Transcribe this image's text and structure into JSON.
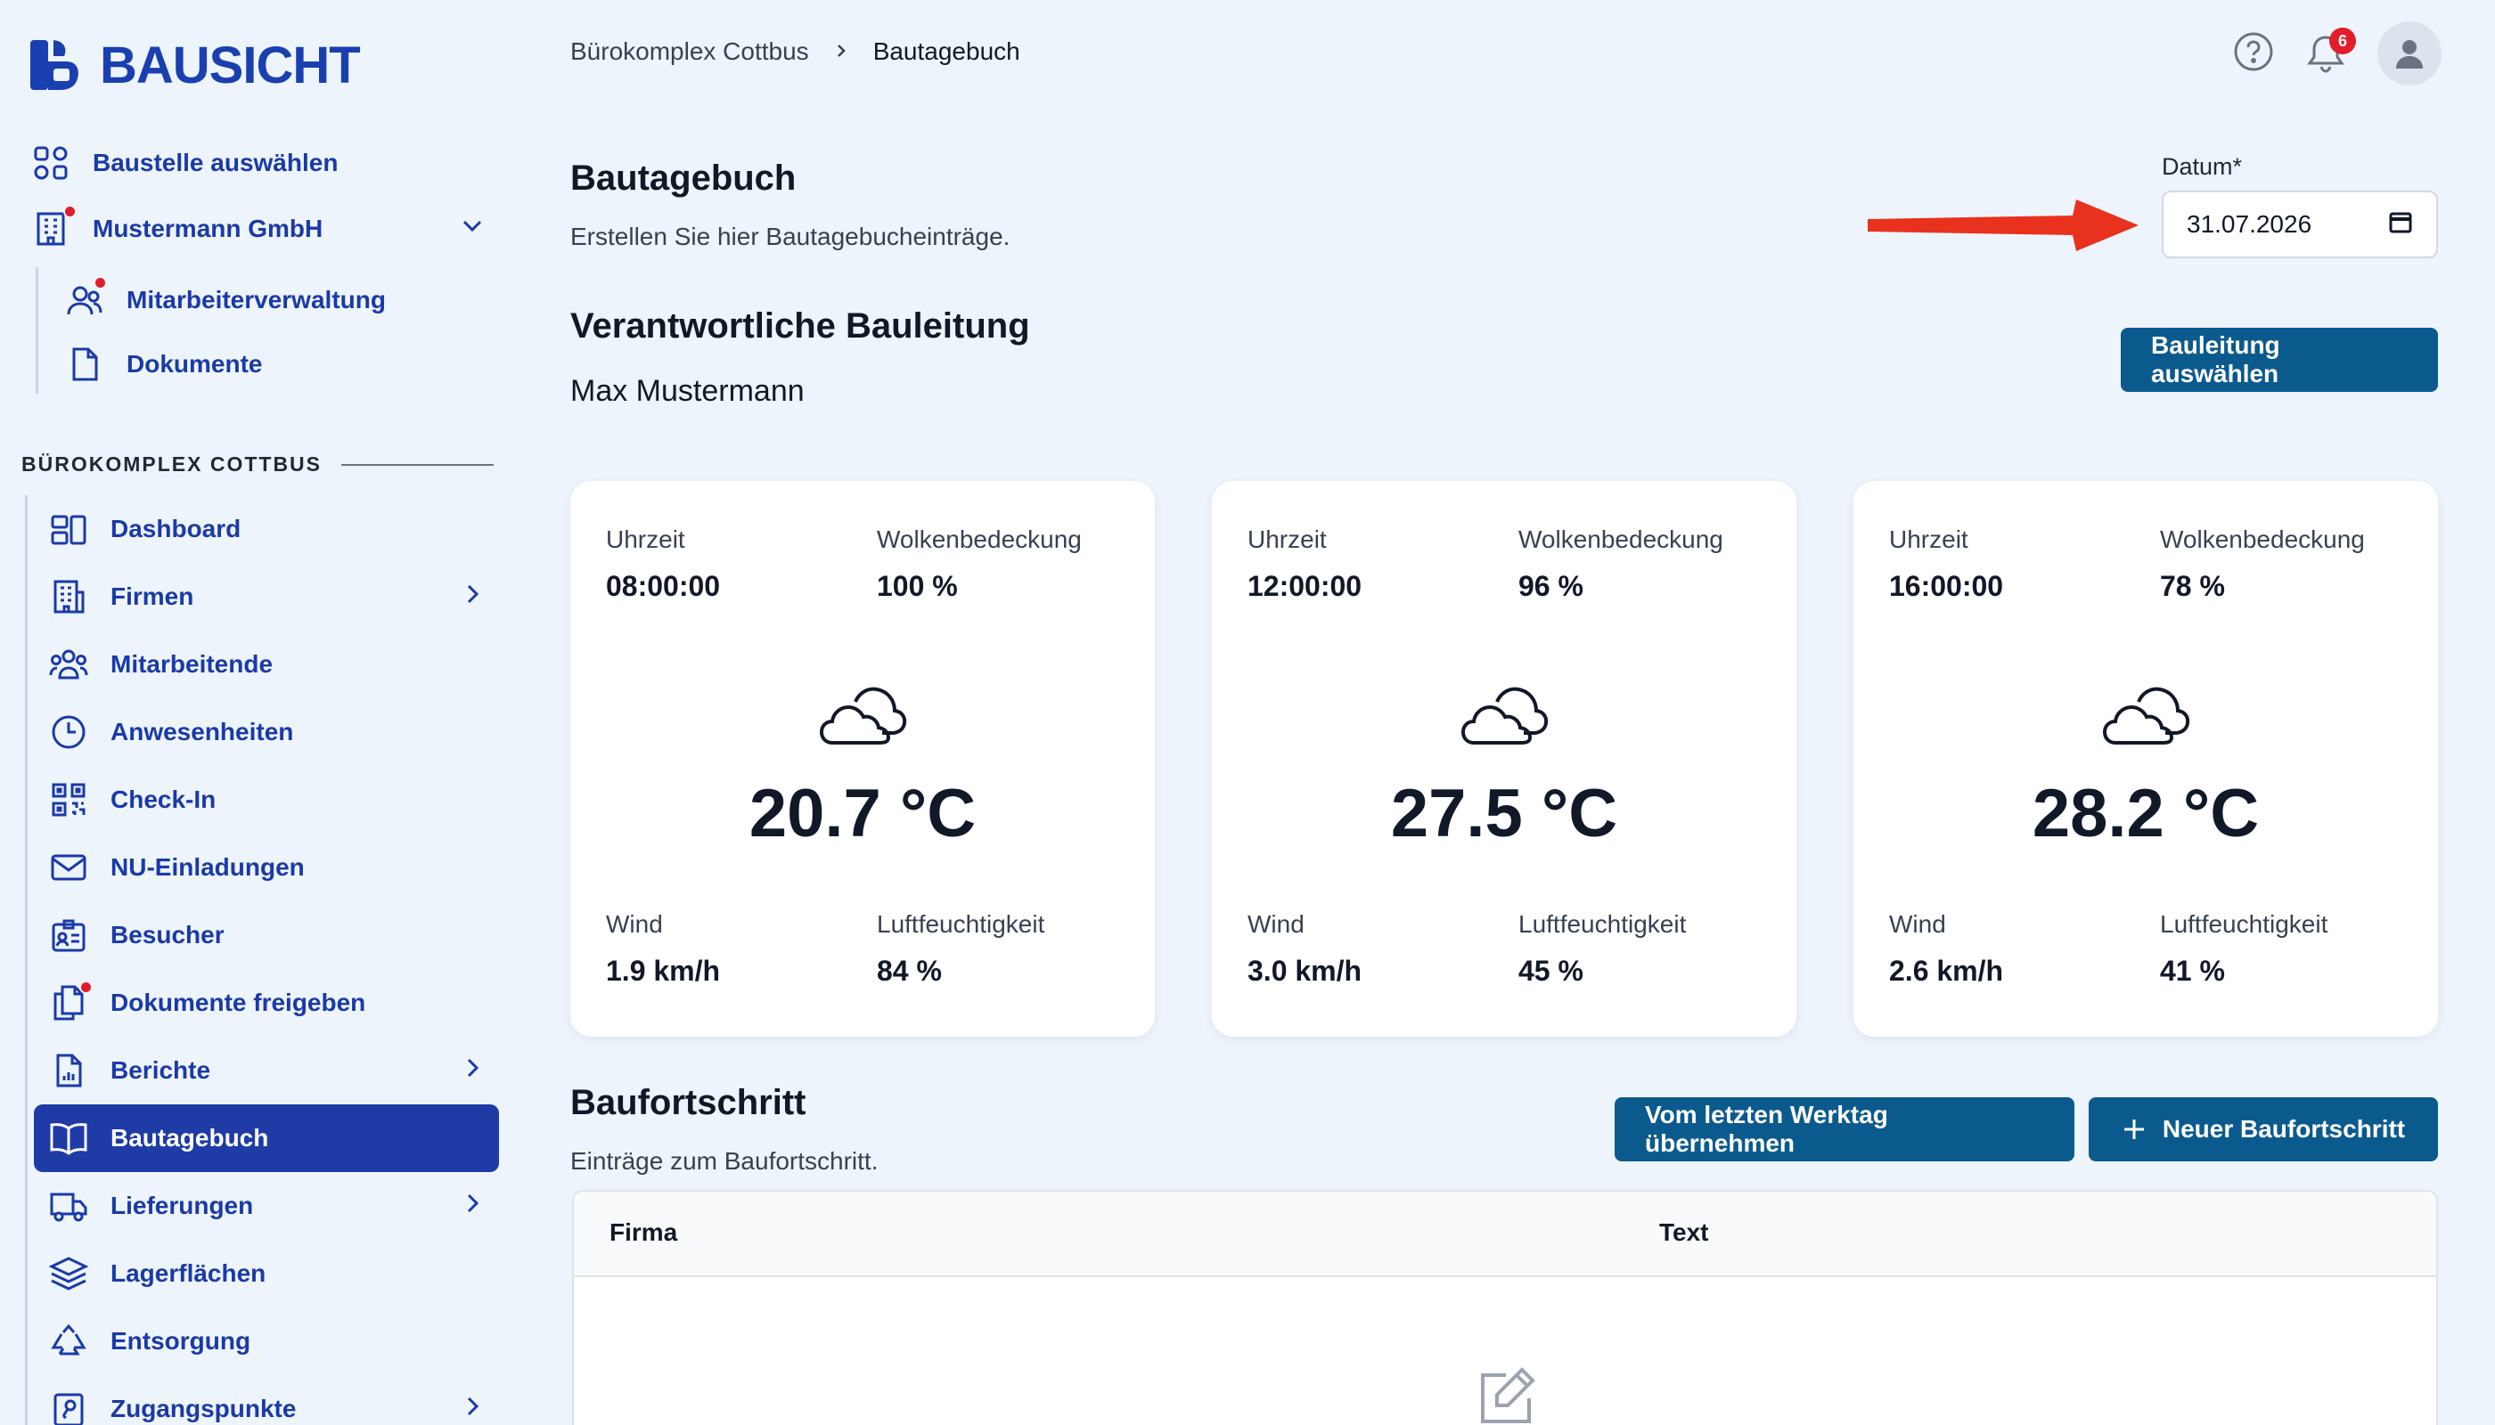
{
  "brand": {
    "name": "BAUSICHT"
  },
  "sidebar": {
    "top_items": [
      {
        "label": "Baustelle auswählen"
      },
      {
        "label": "Mustermann GmbH"
      }
    ],
    "company_items": [
      {
        "label": "Mitarbeiterverwaltung"
      },
      {
        "label": "Dokumente"
      }
    ],
    "section_title": "BÜROKOMPLEX COTTBUS",
    "items": [
      {
        "label": "Dashboard"
      },
      {
        "label": "Firmen"
      },
      {
        "label": "Mitarbeitende"
      },
      {
        "label": "Anwesenheiten"
      },
      {
        "label": "Check-In"
      },
      {
        "label": "NU-Einladungen"
      },
      {
        "label": "Besucher"
      },
      {
        "label": "Dokumente freigeben"
      },
      {
        "label": "Berichte"
      },
      {
        "label": "Bautagebuch"
      },
      {
        "label": "Lieferungen"
      },
      {
        "label": "Lagerflächen"
      },
      {
        "label": "Entsorgung"
      },
      {
        "label": "Zugangspunkte"
      }
    ]
  },
  "header": {
    "breadcrumb": [
      "Bürokomplex Cottbus",
      "Bautagebuch"
    ],
    "notification_count": "6"
  },
  "page": {
    "title": "Bautagebuch",
    "subtitle": "Erstellen Sie hier Bautagebucheinträge.",
    "date_label": "Datum*",
    "date_value": "31.07.2026",
    "leader_heading": "Verantwortliche Bauleitung",
    "leader_name": "Max Mustermann",
    "leader_button": "Bauleitung auswählen"
  },
  "weather": {
    "labels": {
      "time": "Uhrzeit",
      "clouds": "Wolkenbedeckung",
      "wind": "Wind",
      "humidity": "Luftfeuchtigkeit"
    },
    "cards": [
      {
        "time": "08:00:00",
        "clouds": "100 %",
        "temp": "20.7 °C",
        "wind": "1.9 km/h",
        "humidity": "84 %"
      },
      {
        "time": "12:00:00",
        "clouds": "96 %",
        "temp": "27.5 °C",
        "wind": "3.0 km/h",
        "humidity": "45 %"
      },
      {
        "time": "16:00:00",
        "clouds": "78 %",
        "temp": "28.2 °C",
        "wind": "2.6 km/h",
        "humidity": "41 %"
      }
    ]
  },
  "progress": {
    "title": "Baufortschritt",
    "subtitle": "Einträge zum Baufortschritt.",
    "copy_button": "Vom letzten Werktag übernehmen",
    "new_button": "Neuer Baufortschritt",
    "columns": [
      "Firma",
      "Text"
    ]
  },
  "colors": {
    "brand": "#1a3fb0",
    "active": "#1e3ba6",
    "button": "#0b5a8e",
    "alert": "#e11d2a",
    "arrow": "#e8321e"
  }
}
